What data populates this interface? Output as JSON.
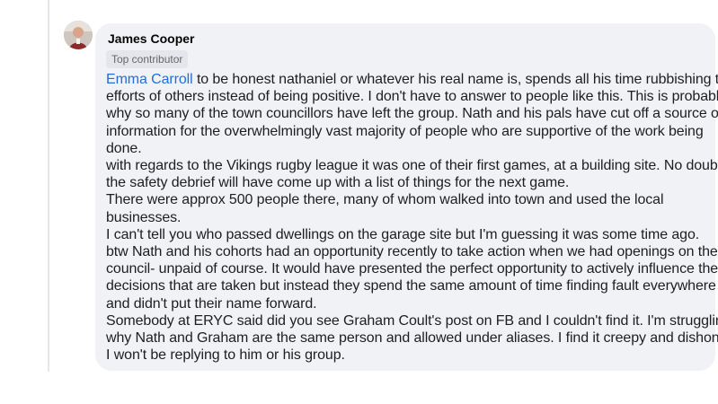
{
  "comment": {
    "author": "James Cooper",
    "badge": "Top contributor",
    "mention": "Emma Carroll",
    "lines": [
      " to be honest nathaniel or whatever his real name is, spends all his time rubbishing the",
      "efforts of others instead of being positive. I don't have to answer to people like this. This is probably",
      "why so many of the town councillors have left the group. Nath and his pals have cut off a source of",
      "information for the overwhelmingly vast majority of people who are supportive of the work being",
      "done.",
      "with regards to the Vikings rugby league it was one of their first games, at a building site. No doubt",
      "the safety debrief will have come up with a list of things for the next game.",
      "There were approx 500 people there, many of whom walked into town and used the local",
      "businesses.",
      "I can't tell you who passed dwellings on the garage site but I'm guessing it was some time ago.",
      "btw Nath and his cohorts had an opportunity recently to take action when we had openings on the",
      "council- unpaid of course. It would have presented the perfect opportunity to actively influence the",
      "decisions that are taken but instead they spend the same amount of time finding fault everywhere",
      "and didn't put their name forward.",
      "Somebody at ERYC said did you see Graham Coult's post on FB and I couldn't find it. I'm struggling",
      "why Nath and Graham are the same person and allowed under aliases. I find it creepy and dishonest.",
      "I won't be replying to him or his group."
    ]
  }
}
